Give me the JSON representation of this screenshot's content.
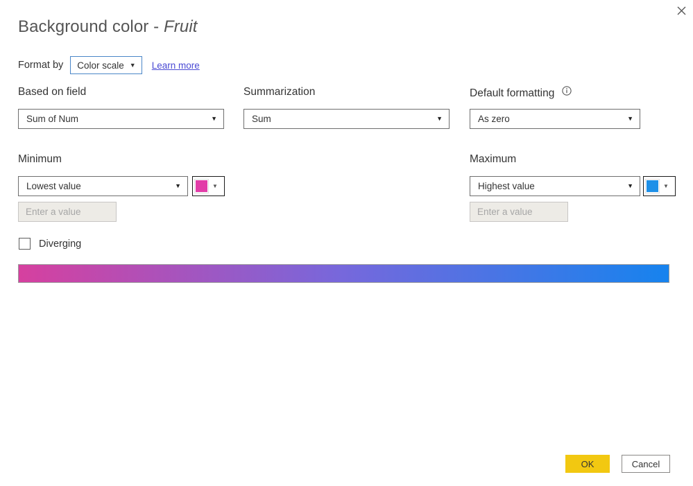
{
  "dialog": {
    "title_main": "Background color -",
    "title_field": "Fruit",
    "close_icon": "close-icon"
  },
  "format_by": {
    "label": "Format by",
    "selected": "Color scale",
    "caret": "▼",
    "learn_more": "Learn more"
  },
  "based_on_field": {
    "label": "Based on field",
    "selected": "Sum of Num",
    "caret": "▼"
  },
  "summarization": {
    "label": "Summarization",
    "selected": "Sum",
    "caret": "▼"
  },
  "default_formatting": {
    "label": "Default formatting",
    "info_icon": "info-icon",
    "selected": "As zero",
    "caret": "▼"
  },
  "minimum": {
    "label": "Minimum",
    "selected": "Lowest value",
    "caret": "▼",
    "value_placeholder": "Enter a value",
    "color": "#E23DA8",
    "color_caret": "▼"
  },
  "maximum": {
    "label": "Maximum",
    "selected": "Highest value",
    "caret": "▼",
    "value_placeholder": "Enter a value",
    "color": "#1E90E8",
    "color_caret": "▼"
  },
  "diverging": {
    "label": "Diverging",
    "checked": false
  },
  "gradient_preview": {
    "start_color": "#D6409F",
    "mid_color": "#7668DC",
    "end_color": "#1683EE"
  },
  "footer": {
    "ok_label": "OK",
    "cancel_label": "Cancel"
  },
  "theme": {
    "accent_yellow": "#F2C811",
    "link_blue": "#4A4AD4",
    "focus_blue": "#4A86C8"
  }
}
